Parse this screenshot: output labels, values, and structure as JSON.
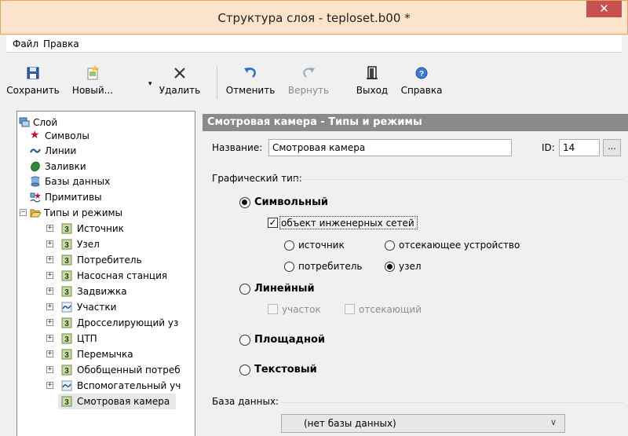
{
  "window": {
    "title": "Структура слоя - teploset.b00 *"
  },
  "menu": [
    {
      "label": "Файл"
    },
    {
      "label": "Правка"
    }
  ],
  "toolbar": {
    "save": "Сохранить",
    "new": "Новый...",
    "delete": "Удалить",
    "undo": "Отменить",
    "redo": "Вернуть",
    "exit": "Выход",
    "help": "Справка"
  },
  "tree": {
    "root": "Слой",
    "children": [
      {
        "label": "Символы",
        "icon": "star-icon"
      },
      {
        "label": "Линии",
        "icon": "line-icon"
      },
      {
        "label": "Заливки",
        "icon": "fill-icon"
      },
      {
        "label": "Базы данных",
        "icon": "database-icon"
      },
      {
        "label": "Примитивы",
        "icon": "primitives-icon"
      }
    ],
    "types_node": "Типы и режимы",
    "types": [
      {
        "label": "Источник",
        "kind": "symbol"
      },
      {
        "label": "Узел",
        "kind": "symbol"
      },
      {
        "label": "Потребитель",
        "kind": "symbol"
      },
      {
        "label": "Насосная станция",
        "kind": "symbol"
      },
      {
        "label": "Задвижка",
        "kind": "symbol"
      },
      {
        "label": "Участки",
        "kind": "line"
      },
      {
        "label": "Дросселирующий уз",
        "kind": "symbol"
      },
      {
        "label": "ЦТП",
        "kind": "symbol"
      },
      {
        "label": "Перемычка",
        "kind": "symbol"
      },
      {
        "label": "Обобщенный потреб",
        "kind": "symbol"
      },
      {
        "label": "Вспомогательный уч",
        "kind": "line"
      },
      {
        "label": "Смотровая камера",
        "kind": "symbol"
      }
    ]
  },
  "panel": {
    "header": "Смотровая камера - Типы и режимы",
    "name_label": "Название:",
    "name_value": "Смотровая камера",
    "id_label": "ID:",
    "id_value": "14",
    "browse_label": "...",
    "graphic_type_label": "Графический тип:",
    "symbolic": "Символьный",
    "engineering_checkbox": "объект инженерных сетей",
    "source": "источник",
    "shutoff_device": "отсекающее устройство",
    "consumer": "потребитель",
    "node": "узел",
    "linear": "Линейный",
    "section": "участок",
    "shutoff": "отсекающий",
    "area": "Площадной",
    "text": "Текстовый",
    "database_label": "База данных:",
    "database_value": "(нет базы данных)"
  },
  "colors": {
    "titlebar_bg": "#fbe3cc",
    "close_bg": "#c75050",
    "panel_header_bg": "#8a8a8a"
  }
}
